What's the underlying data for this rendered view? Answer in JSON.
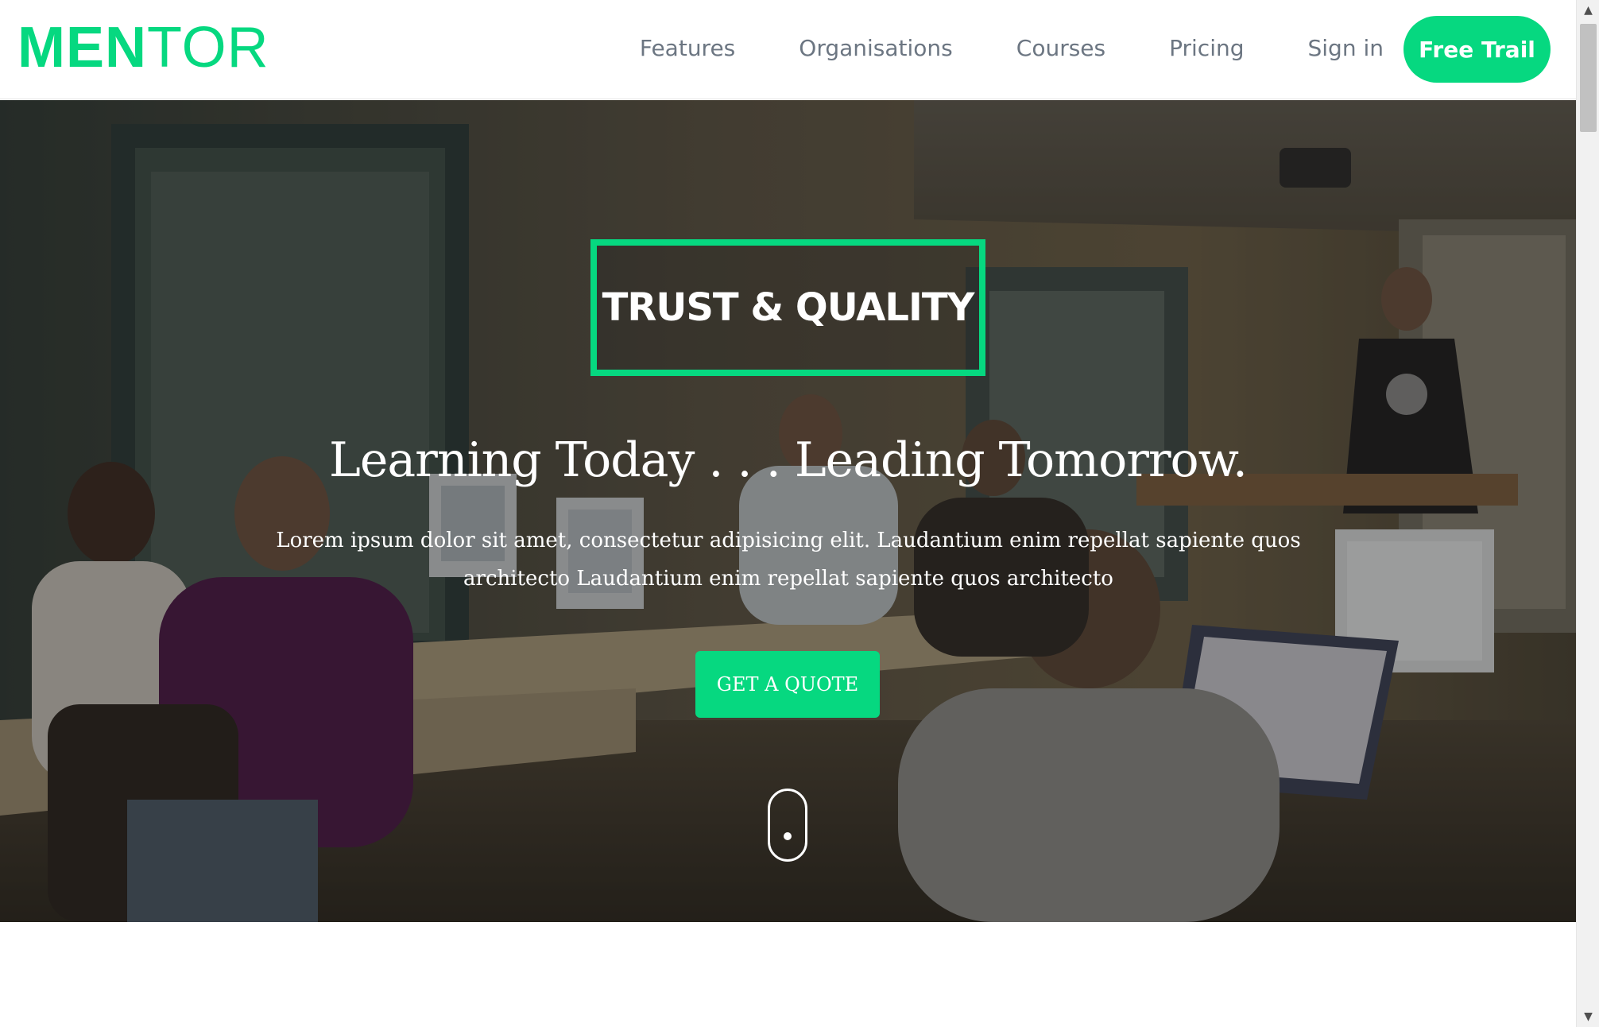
{
  "brand": {
    "logo_bold": "MEN",
    "logo_light": "TOR",
    "accent_color": "#06d880"
  },
  "nav": {
    "items": [
      {
        "label": "Features"
      },
      {
        "label": "Organisations"
      },
      {
        "label": "Courses"
      },
      {
        "label": "Pricing"
      },
      {
        "label": "Sign in"
      }
    ],
    "cta_label": "Free Trail"
  },
  "hero": {
    "badge": "TRUST & QUALITY",
    "title": "Learning Today . . . Leading Tomorrow.",
    "subtitle": "Lorem ipsum dolor sit amet, consectetur adipisicing elit. Laudantium enim repellat sapiente quos architecto Laudantium enim repellat sapiente quos architecto",
    "cta_label": "GET A QUOTE",
    "background": "classroom-photo",
    "scroll_indicator_icon": "mouse-scroll-icon"
  },
  "scrollbar": {
    "up_icon": "arrow-up-icon",
    "down_icon": "arrow-down-icon"
  }
}
